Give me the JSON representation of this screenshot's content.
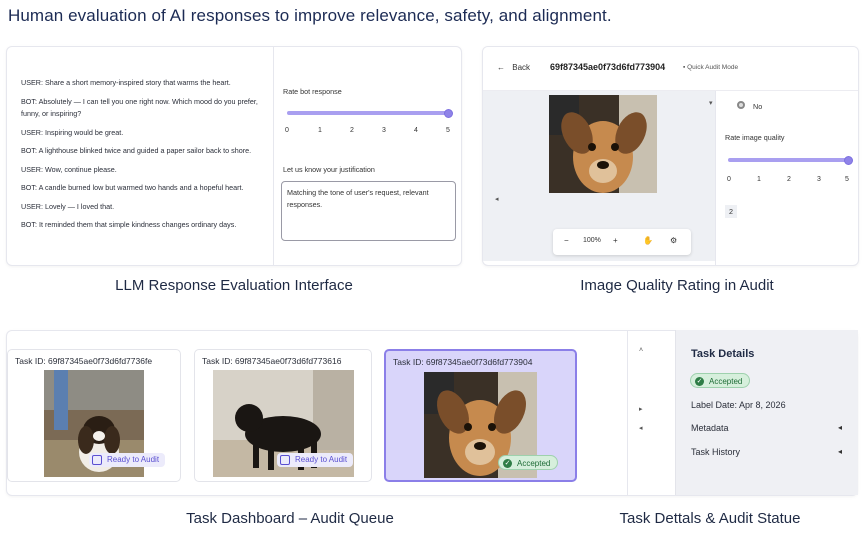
{
  "headline": "Human evaluation of AI responses to improve relevance, safety, and alignment.",
  "captions": {
    "llm": "LLM Response Evaluation Interface",
    "image": "Image Quality Rating in Audit",
    "dashboard": "Task Dashboard – Audit Queue",
    "details": "Task Dettals & Audit Statue"
  },
  "llm_panel": {
    "chat": [
      "USER: Share a short memory-inspired story that warms the heart.",
      "BOT: Absolutely — I can tell you one right now. Which mood do you prefer, funny, or inspiring?",
      "USER: Inspiring would be great.",
      "BOT: A lighthouse blinked twice and guided a paper sailor back to shore.",
      "USER: Wow, continue please.",
      "BOT: A candle burned low but warmed two hands and a hopeful heart.",
      "USER: Lovely — I loved that.",
      "BOT: It reminded them that simple kindness changes ordinary days."
    ],
    "rate_label": "Rate bot response",
    "rating": 5,
    "ticks": [
      "0",
      "1",
      "2",
      "3",
      "4",
      "5"
    ],
    "justification_label": "Let us know your justification",
    "justification_value": "Matching the tone of user's request, relevant responses."
  },
  "image_panel": {
    "back_label": "Back",
    "task_hash": "69f87345ae0f73d6fd773904",
    "quick_audit": "Quick Audit Mode",
    "no_option": "No",
    "rate_label": "Rate image quality",
    "rating": 5,
    "ticks": [
      "0",
      "1",
      "2",
      "3",
      "5"
    ],
    "selected_value": "2",
    "zoom": "100%",
    "zoom_minus": "−",
    "zoom_plus": "+"
  },
  "dashboard": {
    "cards": [
      {
        "task_id": "Task ID: 69f87345ae0f73d6fd7736fe",
        "badge": "Ready to Audit"
      },
      {
        "task_id": "Task ID: 69f87345ae0f73d6fd773616",
        "badge": "Ready to Audit"
      },
      {
        "task_id": "Task ID: 69f87345ae0f73d6fd773904",
        "badge": "Accepted"
      }
    ]
  },
  "details": {
    "title": "Task Details",
    "status": "Accepted",
    "label_date": "Label Date: Apr 8, 2026",
    "metadata": "Metadata",
    "history": "Task History"
  },
  "colors": {
    "accent": "#8f83e8",
    "accepted_bg": "#d6efdc",
    "accepted_text": "#1d6b35"
  }
}
